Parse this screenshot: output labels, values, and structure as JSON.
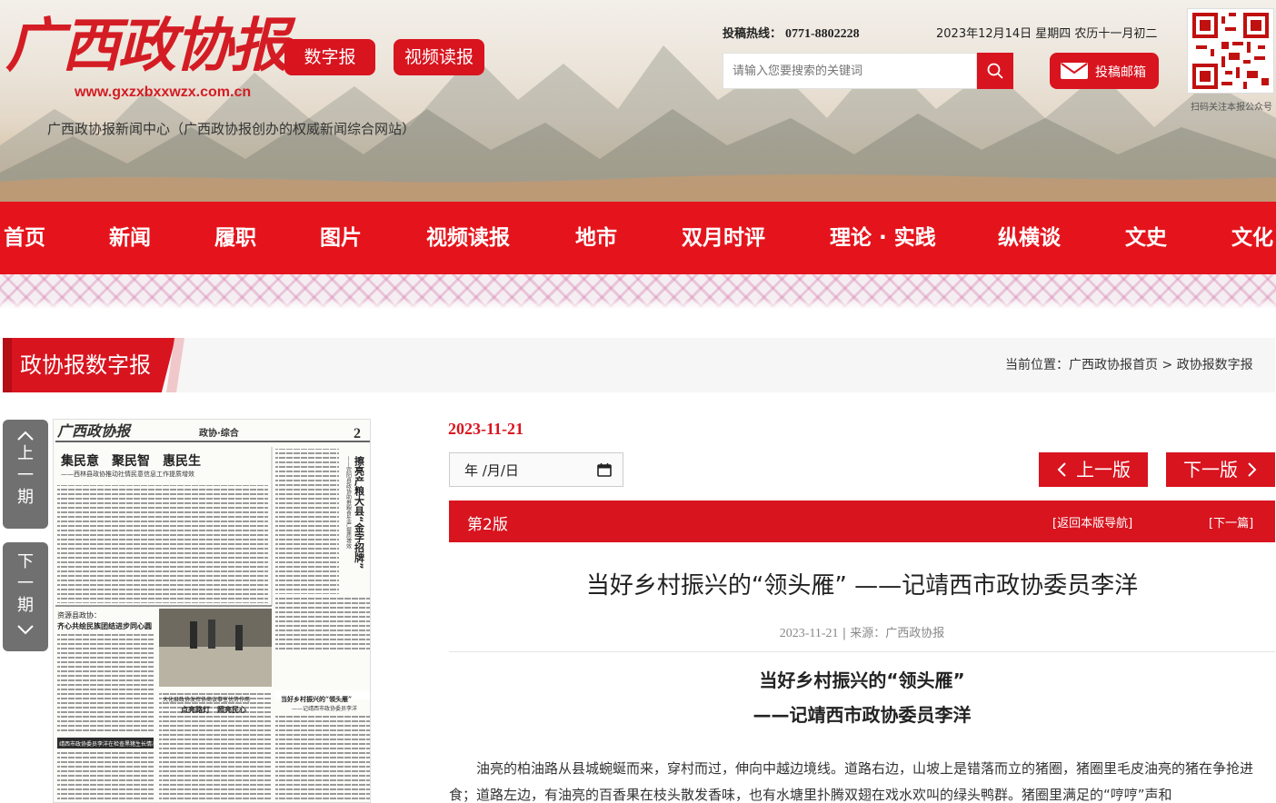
{
  "header": {
    "logo_text": "广西政协报",
    "logo_url": "www.gxzxbxxwzx.com.cn",
    "site_description": "广西政协报新闻中心（广西政协报创办的权威新闻综合网站）",
    "digital_button": "数字报",
    "video_button": "视频读报",
    "hotline_label": "投稿热线：",
    "hotline_number": "0771-8802228",
    "date_text": "2023年12月14日 星期四 农历十一月初二",
    "search_placeholder": "请输入您要搜索的关键词",
    "mail_button": "投稿邮箱",
    "qr_caption": "扫码关注本报公众号"
  },
  "nav": {
    "items": [
      "首页",
      "新闻",
      "履职",
      "图片",
      "视频读报",
      "地市",
      "双月时评",
      "理论 · 实践",
      "纵横谈",
      "文史",
      "文化"
    ]
  },
  "section": {
    "title": "政协报数字报",
    "breadcrumb_prefix": "当前位置：",
    "breadcrumb_home": "广西政协报首页",
    "breadcrumb_sep": " > ",
    "breadcrumb_current": "政协报数字报"
  },
  "side": {
    "prev_label": [
      "上",
      "一",
      "期"
    ],
    "next_label": [
      "下",
      "一",
      "期"
    ]
  },
  "paper_thumb": {
    "masthead": "广西政协报",
    "page_section": "政协·综合",
    "page_no": "2",
    "headline_1": "集民意　聚民智　惠民生",
    "headline_1_sub": "——西林县政协推动社情民意信息工作提质增效",
    "headline_2": "资源县政协：",
    "headline_2_sub": "齐心共绘民族团结进步同心圆",
    "headline_3": "大化县政协发挥协商议事室优势作用",
    "headline_3_sub": "点亮路灯　照亮民心",
    "headline_4": "当好乡村振兴的“领头雁”",
    "headline_4_sub": "——记靖西市政协委员李洋",
    "vertical_headline": "擦亮产粮大县“金字招牌”",
    "vertical_sub": "——宾阳县政协助推粮食生产提质增效",
    "box_caption": "靖西市政协委员李洋在检查黑猪生长情况"
  },
  "content": {
    "issue_date": "2023-11-21",
    "date_input_value": "年 /月/日",
    "prev_edition": "上一版",
    "next_edition": "下一版",
    "edition_label": "第2版",
    "back_to_nav": "[返回本版导航]",
    "next_article": "[下一篇]",
    "title": "当好乡村振兴的“领头雁” ——记靖西市政协委员李洋",
    "meta_date": "2023-11-21",
    "meta_sep": " | ",
    "meta_source": "来源：广西政协报",
    "subtitle_1": "当好乡村振兴的“领头雁”",
    "subtitle_2": "——记靖西市政协委员李洋",
    "paragraph_1": "油亮的柏油路从县城蜿蜒而来，穿村而过，伸向中越边境线。道路右边，山坡上是错落而立的猪圈，猪圈里毛皮油亮的猪在争抢进食；道路左边，有油亮的百香果在枝头散发香味，也有水塘里扑腾双翅在戏水欢叫的绿头鸭群。猪圈里满足的“哼哼”声和"
  },
  "colors": {
    "brand_red": "#d8141f",
    "nav_red": "#e5141c",
    "gray_button": "#707070"
  },
  "icons": {
    "search": "search-icon",
    "mail": "mail-icon",
    "calendar": "calendar-icon",
    "chevron_up": "chevron-up-icon",
    "chevron_down": "chevron-down-icon",
    "chevron_left": "chevron-left-icon",
    "chevron_right": "chevron-right-icon"
  }
}
